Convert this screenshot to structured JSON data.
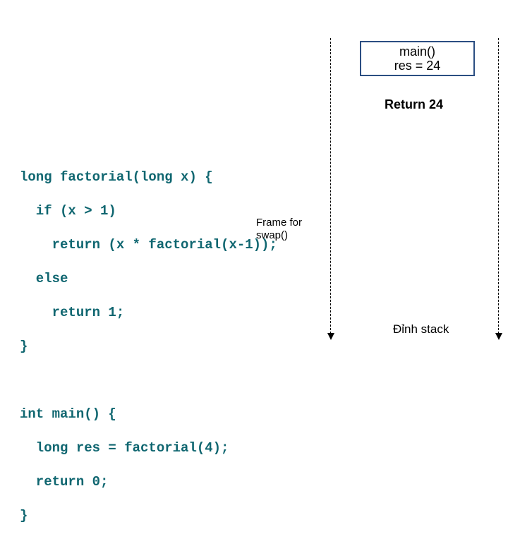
{
  "code": {
    "factorial": {
      "l1": "long factorial(long x) {",
      "l2": "  if (x > 1)",
      "l3": "    return (x * factorial(x-1));",
      "l4": "  else",
      "l5": "    return 1;",
      "l6": "}"
    },
    "main": {
      "l1": "int main() {",
      "l2": "  long res = factorial(4);",
      "l3": "  return 0;",
      "l4": "}"
    }
  },
  "frameLabel": {
    "line1": "Frame for",
    "line2": "swap()"
  },
  "stackBox": {
    "line1": "main()",
    "line2": "res = 24"
  },
  "returnLabel": "Return 24",
  "bottomLabel": "Đỉnh stack"
}
